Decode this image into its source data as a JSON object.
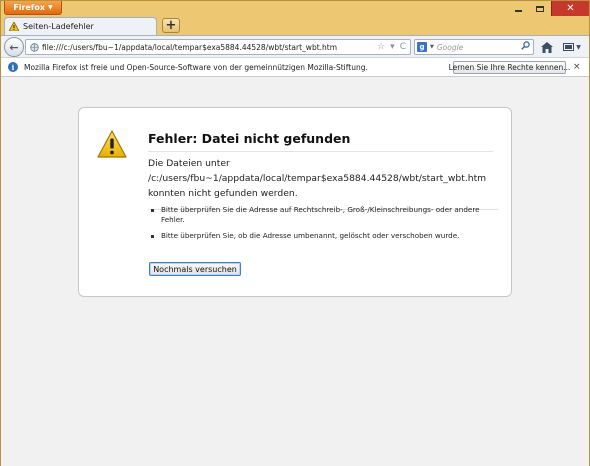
{
  "titlebar": {
    "app_button_label": "Firefox",
    "app_button_caret": "▼",
    "minimize_label": "",
    "maximize_label": "",
    "close_label": "✕"
  },
  "tabs": [
    {
      "label": "Seiten-Ladefehler",
      "icon": "warning-icon"
    }
  ],
  "new_tab_label": "+",
  "nav": {
    "back_label": "←",
    "url": "file:///c:/users/fbu~1/appdata/local/tempar$exa5884.44528/wbt/start_wbt.htm",
    "search_engine": "Google",
    "search_engine_initial": "g",
    "search_placeholder": "Google",
    "bookmark_star": "☆",
    "reload_glyph": "C",
    "search_go_glyph": "⚲"
  },
  "notification": {
    "text": "Mozilla Firefox ist freie und Open-Source-Software von der gemeinnützigen Mozilla-Stiftung.",
    "button_label": "Lernen Sie Ihre Rechte kennen...",
    "close_label": "×"
  },
  "error_page": {
    "title": "Fehler: Datei nicht gefunden",
    "description": "Die Dateien unter /c:/users/fbu~1/appdata/local/tempar$exa5884.44528/wbt/start_wbt.htm konnten nicht gefunden werden.",
    "suggestions": [
      "Bitte überprüfen Sie die Adresse auf Rechtschreib-, Groß-/Kleinschreibungs- oder andere Fehler.",
      "Bitte überprüfen Sie, ob die Adresse umbenannt, gelöscht oder verschoben wurde."
    ],
    "retry_label": "Nochmals versuchen"
  },
  "colors": {
    "frame": "#eec772",
    "firefox_button": "#e06a12",
    "close_button": "#c7382c",
    "toolbar": "#eef1f5",
    "content_background": "#f1f1f1",
    "focus_border": "#3c7fd1"
  }
}
